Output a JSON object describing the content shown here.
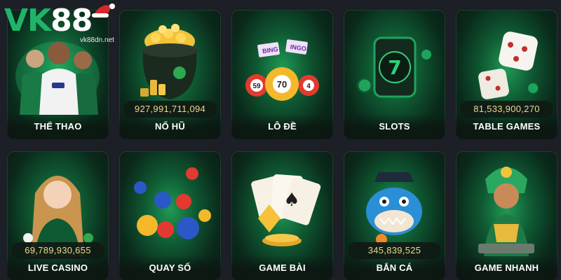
{
  "logo": {
    "brand": "VK88",
    "brand_part1": "VK",
    "brand_part2": "88",
    "domain": "vk88dn.net"
  },
  "cards": [
    {
      "label": "THỂ THAO",
      "jackpot": "",
      "icon": "soccer-players-icon"
    },
    {
      "label": "NỔ HŨ",
      "jackpot": "927,991,711,094",
      "icon": "gold-pot-icon"
    },
    {
      "label": "LÔ ĐỀ",
      "jackpot": "",
      "icon": "bingo-balls-icon"
    },
    {
      "label": "SLOTS",
      "jackpot": "",
      "icon": "slot-reel-icon"
    },
    {
      "label": "TABLE GAMES",
      "jackpot": "81,533,900,270",
      "icon": "dice-icon"
    },
    {
      "label": "LIVE CASINO",
      "jackpot": "69,789,930,655",
      "icon": "dealer-icon"
    },
    {
      "label": "QUAY SỐ",
      "jackpot": "",
      "icon": "lottery-balls-icon"
    },
    {
      "label": "GAME BÀI",
      "jackpot": "",
      "icon": "playing-cards-icon"
    },
    {
      "label": "BẮN CÁ",
      "jackpot": "345,839,525",
      "icon": "fish-shark-icon"
    },
    {
      "label": "GAME NHANH",
      "jackpot": "",
      "icon": "goddess-icon"
    }
  ],
  "colors": {
    "accent_green": "#1fb46a",
    "jackpot_gold": "#f0d98c",
    "background": "#1c1f26"
  }
}
